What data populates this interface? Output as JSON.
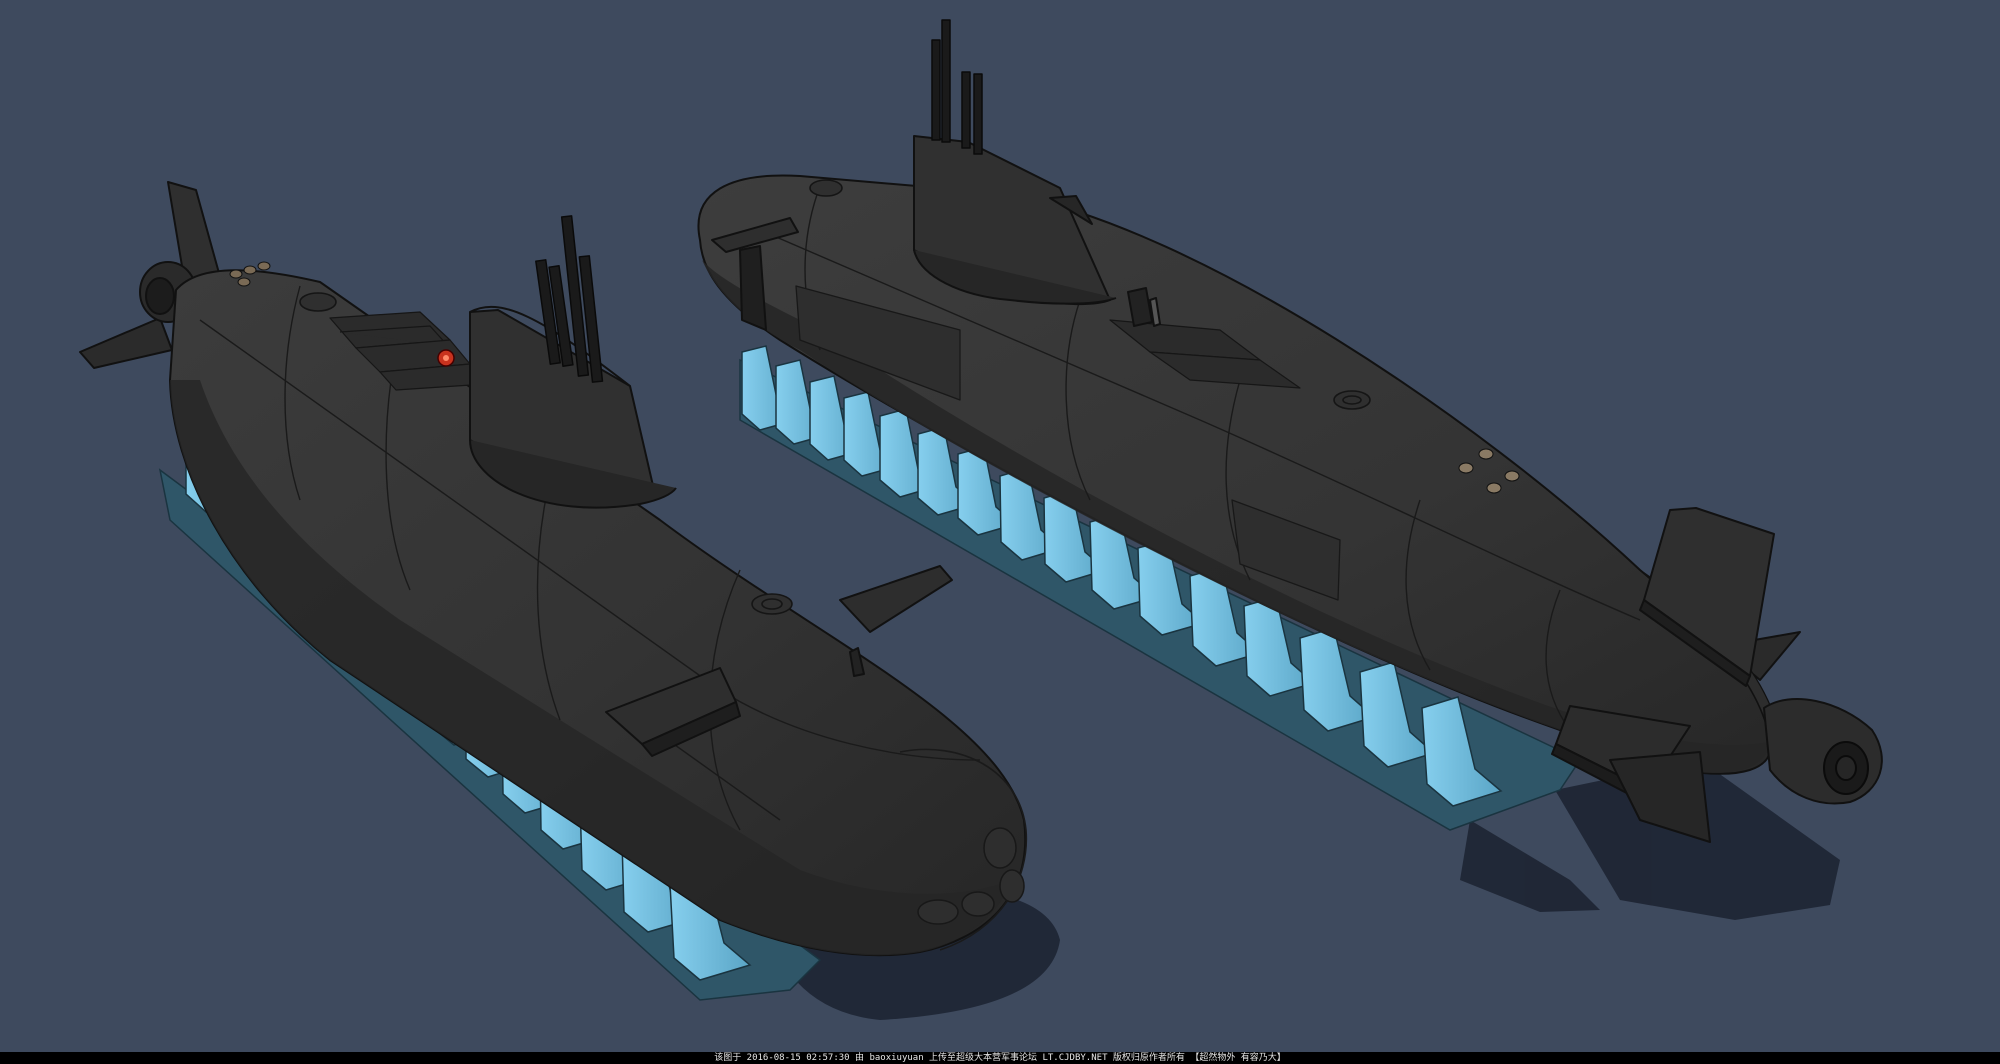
{
  "scene": {
    "background_color": "#3e4a5e",
    "hull_color": "#353535",
    "hull_edge_color": "#111111",
    "cradle_color": "#78c3e2",
    "cradle_shade_color": "#2f5668",
    "shadow_color": "#1b2230",
    "beacon_color": "#c8321e",
    "objects": [
      "submarine-left",
      "submarine-right",
      "support-cradles"
    ]
  },
  "footer": {
    "caption": "该图于 2016-08-15 02:57:30 由 baoxiuyuan 上传至超级大本营军事论坛 LT.CJDBY.NET 版权归原作者所有 【超然物外 有容乃大】"
  }
}
